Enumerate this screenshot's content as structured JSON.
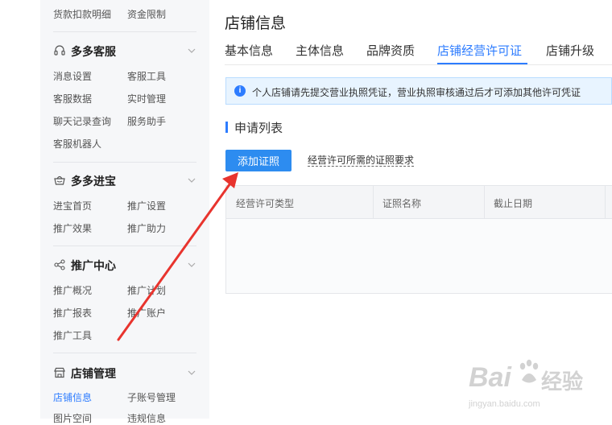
{
  "sidebar": {
    "top_items": [
      "货款扣款明细",
      "资金限制"
    ],
    "groups": [
      {
        "label": "多多客服",
        "icon": "headset-icon",
        "items": [
          "消息设置",
          "客服工具",
          "客服数据",
          "实时管理",
          "聊天记录查询",
          "服务助手",
          "客服机器人"
        ]
      },
      {
        "label": "多多进宝",
        "icon": "treasure-icon",
        "items": [
          "进宝首页",
          "推广设置",
          "推广效果",
          "推广助力"
        ]
      },
      {
        "label": "推广中心",
        "icon": "share-icon",
        "items": [
          "推广概况",
          "推广计划",
          "推广报表",
          "推广账户",
          "推广工具"
        ]
      },
      {
        "label": "店铺管理",
        "icon": "store-icon",
        "items": [
          "店铺信息",
          "子账号管理",
          "图片空间",
          "违规信息"
        ],
        "active_item": "店铺信息"
      }
    ]
  },
  "page": {
    "title": "店铺信息",
    "tabs": [
      "基本信息",
      "主体信息",
      "品牌资质",
      "店铺经营许可证",
      "店铺升级"
    ],
    "active_tab": "店铺经营许可证",
    "notice": "个人店铺请先提交营业执照凭证，营业执照审核通过后才可添加其他许可凭证",
    "section_title": "申请列表",
    "add_button": "添加证照",
    "requirements_link": "经营许可所需的证照要求",
    "table_headers": [
      "经营许可类型",
      "证照名称",
      "截止日期"
    ]
  },
  "watermark": {
    "brand": "Bai",
    "brand_cn": "经验",
    "url": "jingyan.baidu.com"
  },
  "colors": {
    "accent": "#2d7cff",
    "button": "#2d8cf0",
    "arrow": "#e8342e",
    "notice_bg": "#e8f4ff"
  }
}
